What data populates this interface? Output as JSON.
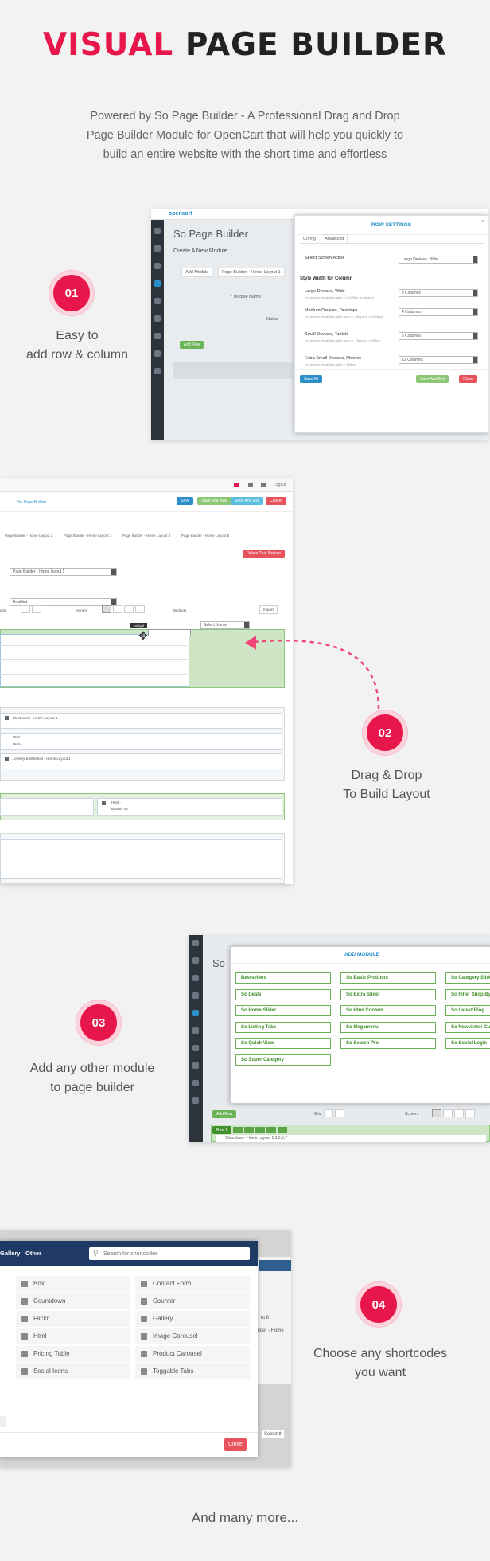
{
  "header": {
    "title_accent": "VISUAL",
    "title_rest": "PAGE BUILDER",
    "intro": [
      "Powered by So Page Builder - A Professional Drag and Drop",
      "Page Builder Module for OpenCart that will help you quickly to",
      "build an entire website with the short time and effortless"
    ]
  },
  "steps": [
    {
      "num": "01",
      "line1": "Easy to",
      "line2": "add row & column"
    },
    {
      "num": "02",
      "line1": "Drag & Drop",
      "line2": "To Build Layout"
    },
    {
      "num": "03",
      "line1": "Add any other module",
      "line2": "to page builder"
    },
    {
      "num": "04",
      "line1": "Choose any shortcodes",
      "line2": "you want"
    }
  ],
  "shot1": {
    "logo": "opencart",
    "page_title": "So Page Builder",
    "create_label": "Create A New Module",
    "add_module": "Add Module",
    "layout_tab": "Page Builder - Home Layout 1",
    "module_name": "* Module Name",
    "status": "Status",
    "add_row": "Add Row",
    "modal": {
      "title": "ROW SETTINGS",
      "tabs": [
        "Config",
        "Advanced"
      ],
      "screen_label": "Select Screen Active",
      "screen_value": "Large Devices, Wide",
      "width_heading": "Style Width for Column",
      "rows": [
        {
          "label": "Large Devices, Wide",
          "sub": "(for device resolution width >= 1200px or greater)",
          "value": "3 Columns"
        },
        {
          "label": "Medium Devices, Desktops",
          "sub": "(for device resolution width from >= 992px to < 1200px)",
          "value": "4 Columns"
        },
        {
          "label": "Small Devices, Tablets",
          "sub": "(for device resolution width from >= 768px to < 992px)",
          "value": "6 Columns"
        },
        {
          "label": "Extra Small Devices, Phones",
          "sub": "(for device resolution width < 768px)",
          "value": "12 Columns"
        }
      ],
      "save_all": "Save All",
      "save_exit": "Save And Exit",
      "close": "Close"
    }
  },
  "shot2": {
    "breadcrumb": "So Page Builder",
    "save": "Save",
    "save_new": "Save And New",
    "save_exit": "Save And Exit",
    "cancel": "Cancel",
    "tabs": [
      "Page Builder - Home Layout 2",
      "Page Builder - Home Layout 3",
      "Page Builder - Home Layout 4",
      "Page Builder - Home Layout 5"
    ],
    "delete_btn": "Delete This Module",
    "name_value": "Page Builder - Home layout 1",
    "status_value": "Enabled",
    "grid": "grid",
    "screen": "Screen",
    "widgets": "Widgets",
    "widgets_select": "Select theme",
    "import": "Import",
    "col_label": "col-lg-6",
    "items": [
      "Electronics - Home Layout 1",
      "Html -",
      "Html -",
      "Jewelry & Watches - Home Layout 1",
      "Html -",
      "Banner 04"
    ]
  },
  "shot3": {
    "page_title": "So",
    "modal_title": "ADD MODULE",
    "modules": [
      "Bestsellers",
      "So Basic Products",
      "So Category Slider",
      "So Deals",
      "So Extra Slider",
      "So Filter Shop By",
      "So Home Slider",
      "So Html Content",
      "So Latest Blog",
      "So Listing Tabs",
      "So Megamenu",
      "So Newsletter Custom",
      "So Quick View",
      "So Search Pro",
      "So Social Login",
      "So Super Category"
    ],
    "add_row": "Add Row",
    "grid": "Grid",
    "screen": "Screen",
    "row_tab": "Row 1",
    "slideshow": "Slideshow - Home Layout 1,3,5,6,7"
  },
  "shot4": {
    "tabs": [
      "Gallery",
      "Other"
    ],
    "search_placeholder": "Search for shortcodes",
    "left": [
      "Box",
      "Countdown",
      "Flickr",
      "Html",
      "Pricing Table",
      "Social Icons"
    ],
    "right": [
      "Contact Form",
      "Counter",
      "Gallery",
      "Image Carousel",
      "Product Carousel",
      "Toggable Tabs"
    ],
    "bg_text1": "ut 8",
    "bg_text2": "ilder - Home",
    "bg_select": "Select th",
    "close": "Close"
  },
  "footer": "And many more...",
  "colors": {
    "accent": "#e8174b",
    "blue": "#2a8fc9",
    "green": "#6cb257",
    "navy": "#1f3a64"
  }
}
